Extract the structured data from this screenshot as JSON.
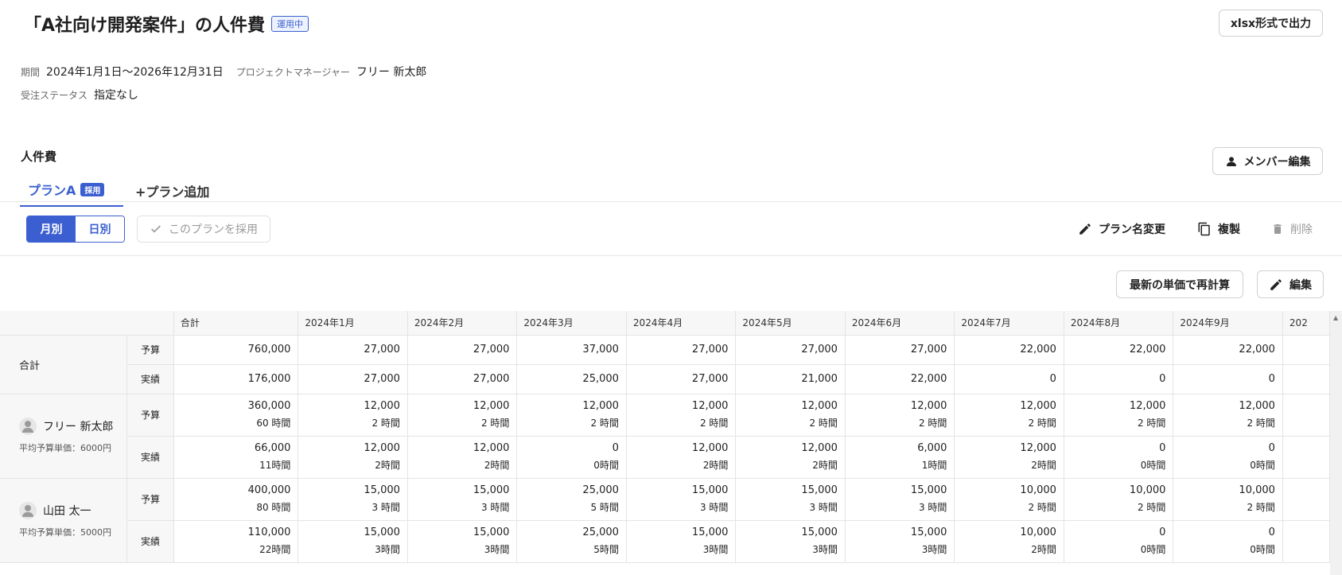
{
  "header": {
    "title": "「A社向け開発案件」の人件費",
    "status_badge": "運用中",
    "export_button": "xlsx形式で出力"
  },
  "meta": {
    "period_label": "期間",
    "period_value": "2024年1月1日～2026年12月31日",
    "pm_label": "プロジェクトマネージャー",
    "pm_value": "フリー 新太郎",
    "order_status_label": "受注ステータス",
    "order_status_value": "指定なし"
  },
  "section": {
    "title": "人件費",
    "member_edit_button": "メンバー編集"
  },
  "tabs": {
    "active_label": "プランA",
    "active_badge": "採用",
    "add_label": "+プラン追加"
  },
  "toolbar": {
    "monthly": "月別",
    "daily": "日別",
    "adopt": "このプランを採用",
    "rename": "プラン名変更",
    "copy": "複製",
    "delete": "削除",
    "recalc": "最新の単価で再計算",
    "edit": "編集"
  },
  "table": {
    "columns": [
      "合計",
      "2024年1月",
      "2024年2月",
      "2024年3月",
      "2024年4月",
      "2024年5月",
      "2024年6月",
      "2024年7月",
      "2024年8月",
      "2024年9月",
      "202"
    ],
    "total": {
      "label": "合計",
      "budget_label": "予算",
      "actual_label": "実績",
      "budget": [
        "760,000",
        "27,000",
        "27,000",
        "37,000",
        "27,000",
        "27,000",
        "27,000",
        "22,000",
        "22,000",
        "22,000"
      ],
      "actual": [
        "176,000",
        "27,000",
        "27,000",
        "25,000",
        "27,000",
        "21,000",
        "22,000",
        "0",
        "0",
        "0"
      ]
    },
    "members": [
      {
        "name": "フリー 新太郎",
        "avg": "平均予算単価：6000円",
        "budget_label": "予算",
        "actual_label": "実績",
        "budget": [
          "360,000",
          "12,000",
          "12,000",
          "12,000",
          "12,000",
          "12,000",
          "12,000",
          "12,000",
          "12,000",
          "12,000"
        ],
        "budget_hours": [
          "60 時間",
          "2 時間",
          "2 時間",
          "2 時間",
          "2 時間",
          "2 時間",
          "2 時間",
          "2 時間",
          "2 時間",
          "2 時間"
        ],
        "actual": [
          "66,000",
          "12,000",
          "12,000",
          "0",
          "12,000",
          "12,000",
          "6,000",
          "12,000",
          "0",
          "0"
        ],
        "actual_hours": [
          "11時間",
          "2時間",
          "2時間",
          "0時間",
          "2時間",
          "2時間",
          "1時間",
          "2時間",
          "0時間",
          "0時間"
        ]
      },
      {
        "name": "山田 太一",
        "avg": "平均予算単価：5000円",
        "budget_label": "予算",
        "actual_label": "実績",
        "budget": [
          "400,000",
          "15,000",
          "15,000",
          "25,000",
          "15,000",
          "15,000",
          "15,000",
          "10,000",
          "10,000",
          "10,000"
        ],
        "budget_hours": [
          "80 時間",
          "3 時間",
          "3 時間",
          "5 時間",
          "3 時間",
          "3 時間",
          "3 時間",
          "2 時間",
          "2 時間",
          "2 時間"
        ],
        "actual": [
          "110,000",
          "15,000",
          "15,000",
          "25,000",
          "15,000",
          "15,000",
          "15,000",
          "10,000",
          "0",
          "0"
        ],
        "actual_hours": [
          "22時間",
          "3時間",
          "3時間",
          "5時間",
          "3時間",
          "3時間",
          "3時間",
          "2時間",
          "0時間",
          "0時間"
        ]
      }
    ]
  }
}
